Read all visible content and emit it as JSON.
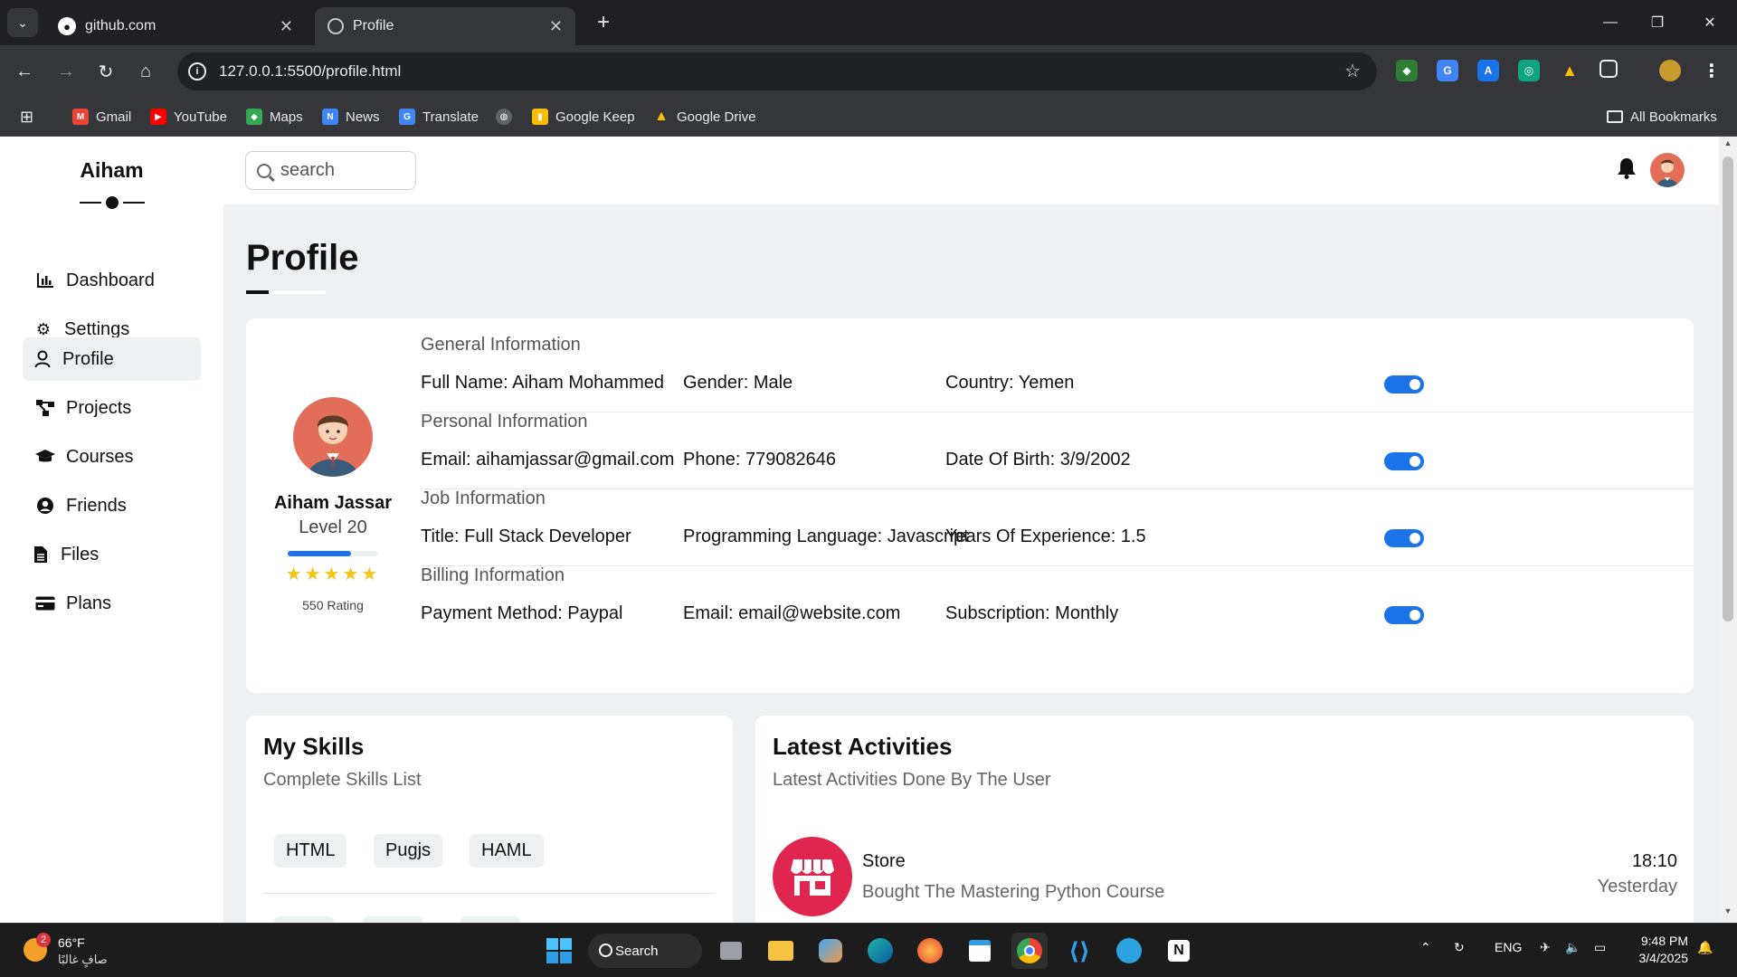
{
  "browser": {
    "tabs": [
      {
        "title": "github.com"
      },
      {
        "title": "Profile"
      }
    ],
    "url": "127.0.0.1:5500/profile.html",
    "bookmarks": [
      {
        "label": "Gmail",
        "color": "#ea4335"
      },
      {
        "label": "YouTube",
        "color": "#ff0000"
      },
      {
        "label": "Maps",
        "color": "#34a853"
      },
      {
        "label": "News",
        "color": "#4285f4"
      },
      {
        "label": "Translate",
        "color": "#4285f4"
      },
      {
        "label": "Google Keep",
        "color": "#fbbc04"
      },
      {
        "label": "Google Drive",
        "color": "#1fa463"
      }
    ],
    "all_bookmarks_label": "All Bookmarks"
  },
  "sidebar": {
    "logo": "Aiham",
    "items": [
      {
        "label": "Dashboard",
        "icon": "chart-icon"
      },
      {
        "label": "Settings",
        "icon": "gear-icon"
      },
      {
        "label": "Profile",
        "icon": "user-icon",
        "active": true
      },
      {
        "label": "Projects",
        "icon": "diagram-icon"
      },
      {
        "label": "Courses",
        "icon": "graduation-cap-icon"
      },
      {
        "label": "Friends",
        "icon": "user-circle-icon"
      },
      {
        "label": "Files",
        "icon": "file-icon"
      },
      {
        "label": "Plans",
        "icon": "credit-card-icon"
      }
    ]
  },
  "header": {
    "search_placeholder": "search"
  },
  "page": {
    "title": "Profile"
  },
  "profile": {
    "name": "Aiham Jassar",
    "level": "Level 20",
    "level_progress": 0.7,
    "stars": 5,
    "stars_text": "★★★★★",
    "rating": "550 Rating"
  },
  "sections": [
    {
      "heading": "General Information",
      "values": [
        "Full Name: Aiham Mohammed",
        "Gender: Male",
        "Country: Yemen"
      ],
      "toggle_on": true
    },
    {
      "heading": "Personal Information",
      "values": [
        "Email: aihamjassar@gmail.com",
        "Phone: 779082646",
        "Date Of Birth: 3/9/2002"
      ],
      "toggle_on": true
    },
    {
      "heading": "Job Information",
      "values": [
        "Title: Full Stack Developer",
        "Programming Language: Javascript",
        "Years Of Experience: 1.5"
      ],
      "toggle_on": true
    },
    {
      "heading": "Billing Information",
      "values": [
        "Payment Method: Paypal",
        "Email: email@website.com",
        "Subscription: Monthly"
      ],
      "toggle_on": true
    }
  ],
  "skills": {
    "title": "My Skills",
    "subtitle": "Complete Skills List",
    "chips": [
      "HTML",
      "Pugjs",
      "HAML"
    ]
  },
  "activities": {
    "title": "Latest Activities",
    "subtitle": "Latest Activities Done By The User",
    "items": [
      {
        "title": "Store",
        "description": "Bought The Mastering Python Course",
        "time": "18:10",
        "day": "Yesterday",
        "icon": "store-icon"
      }
    ]
  },
  "taskbar": {
    "weather_badge": "2",
    "temperature": "66°F",
    "condition": "صافٍ غالبًا",
    "search_label": "Search",
    "language": "ENG",
    "time": "9:48 PM",
    "date": "3/4/2025"
  },
  "colors": {
    "accent": "#1a73e8",
    "star": "#f5c518",
    "activity_icon": "#e0264e",
    "page_bg": "#eef1f1"
  }
}
